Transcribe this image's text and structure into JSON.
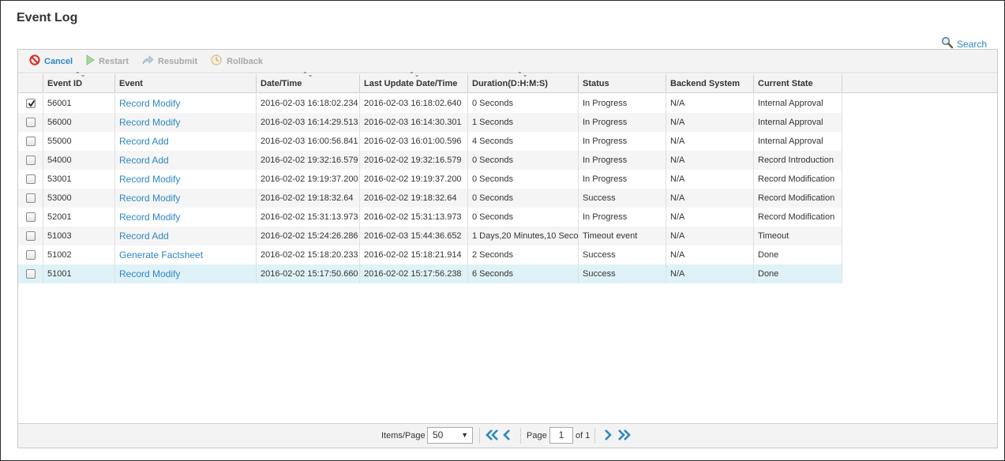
{
  "page": {
    "title": "Event Log",
    "search_label": "Search"
  },
  "toolbar": {
    "cancel": "Cancel",
    "restart": "Restart",
    "resubmit": "Resubmit",
    "rollback": "Rollback"
  },
  "columns": [
    "Event ID",
    "Event",
    "Date/Time",
    "Last Update Date/Time",
    "Duration(D:H:M:S)",
    "Status",
    "Backend System",
    "Current State"
  ],
  "rows": [
    {
      "checked": true,
      "id": "56001",
      "event": "Record Modify",
      "datetime": "2016-02-03 16:18:02.234",
      "updated": "2016-02-03 16:18:02.640",
      "duration": "0 Seconds",
      "status": "In Progress",
      "backend": "N/A",
      "state": "Internal Approval"
    },
    {
      "checked": false,
      "id": "56000",
      "event": "Record Modify",
      "datetime": "2016-02-03 16:14:29.513",
      "updated": "2016-02-03 16:14:30.301",
      "duration": "1 Seconds",
      "status": "In Progress",
      "backend": "N/A",
      "state": "Internal Approval"
    },
    {
      "checked": false,
      "id": "55000",
      "event": "Record Add",
      "datetime": "2016-02-03 16:00:56.841",
      "updated": "2016-02-03 16:01:00.596",
      "duration": "4 Seconds",
      "status": "In Progress",
      "backend": "N/A",
      "state": "Internal Approval"
    },
    {
      "checked": false,
      "id": "54000",
      "event": "Record Add",
      "datetime": "2016-02-02 19:32:16.579",
      "updated": "2016-02-02 19:32:16.579",
      "duration": "0 Seconds",
      "status": "In Progress",
      "backend": "N/A",
      "state": "Record Introduction"
    },
    {
      "checked": false,
      "id": "53001",
      "event": "Record Modify",
      "datetime": "2016-02-02 19:19:37.200",
      "updated": "2016-02-02 19:19:37.200",
      "duration": "0 Seconds",
      "status": "In Progress",
      "backend": "N/A",
      "state": "Record Modification"
    },
    {
      "checked": false,
      "id": "53000",
      "event": "Record Modify",
      "datetime": "2016-02-02 19:18:32.64",
      "updated": "2016-02-02 19:18:32.64",
      "duration": "0 Seconds",
      "status": "Success",
      "backend": "N/A",
      "state": "Record Modification"
    },
    {
      "checked": false,
      "id": "52001",
      "event": "Record Modify",
      "datetime": "2016-02-02 15:31:13.973",
      "updated": "2016-02-02 15:31:13.973",
      "duration": "0 Seconds",
      "status": "In Progress",
      "backend": "N/A",
      "state": "Record Modification"
    },
    {
      "checked": false,
      "id": "51003",
      "event": "Record Add",
      "datetime": "2016-02-02 15:24:26.286",
      "updated": "2016-02-03 15:44:36.652",
      "duration": "1 Days,20 Minutes,10 Seco",
      "status": "Timeout event",
      "backend": "N/A",
      "state": "Timeout"
    },
    {
      "checked": false,
      "id": "51002",
      "event": "Generate Factsheet",
      "datetime": "2016-02-02 15:18:20.233",
      "updated": "2016-02-02 15:18:21.914",
      "duration": "2 Seconds",
      "status": "Success",
      "backend": "N/A",
      "state": "Done"
    },
    {
      "checked": false,
      "id": "51001",
      "event": "Record Modify",
      "datetime": "2016-02-02 15:17:50.660",
      "updated": "2016-02-02 15:17:56.238",
      "duration": "6 Seconds",
      "status": "Success",
      "backend": "N/A",
      "state": "Done",
      "selected": true
    }
  ],
  "pager": {
    "items_per_page_label": "Items/Page",
    "items_per_page": "50",
    "page_label": "Page",
    "page": "1",
    "of_label": "of 1"
  },
  "colors": {
    "link": "#2e86c1",
    "selected_row": "#dff2f8",
    "cancel_icon": "#d9261c"
  },
  "icons": {
    "search": "magnifier-icon",
    "cancel": "no-entry-icon",
    "restart": "play-icon",
    "resubmit": "redo-arrow-icon",
    "rollback": "clock-back-icon"
  }
}
